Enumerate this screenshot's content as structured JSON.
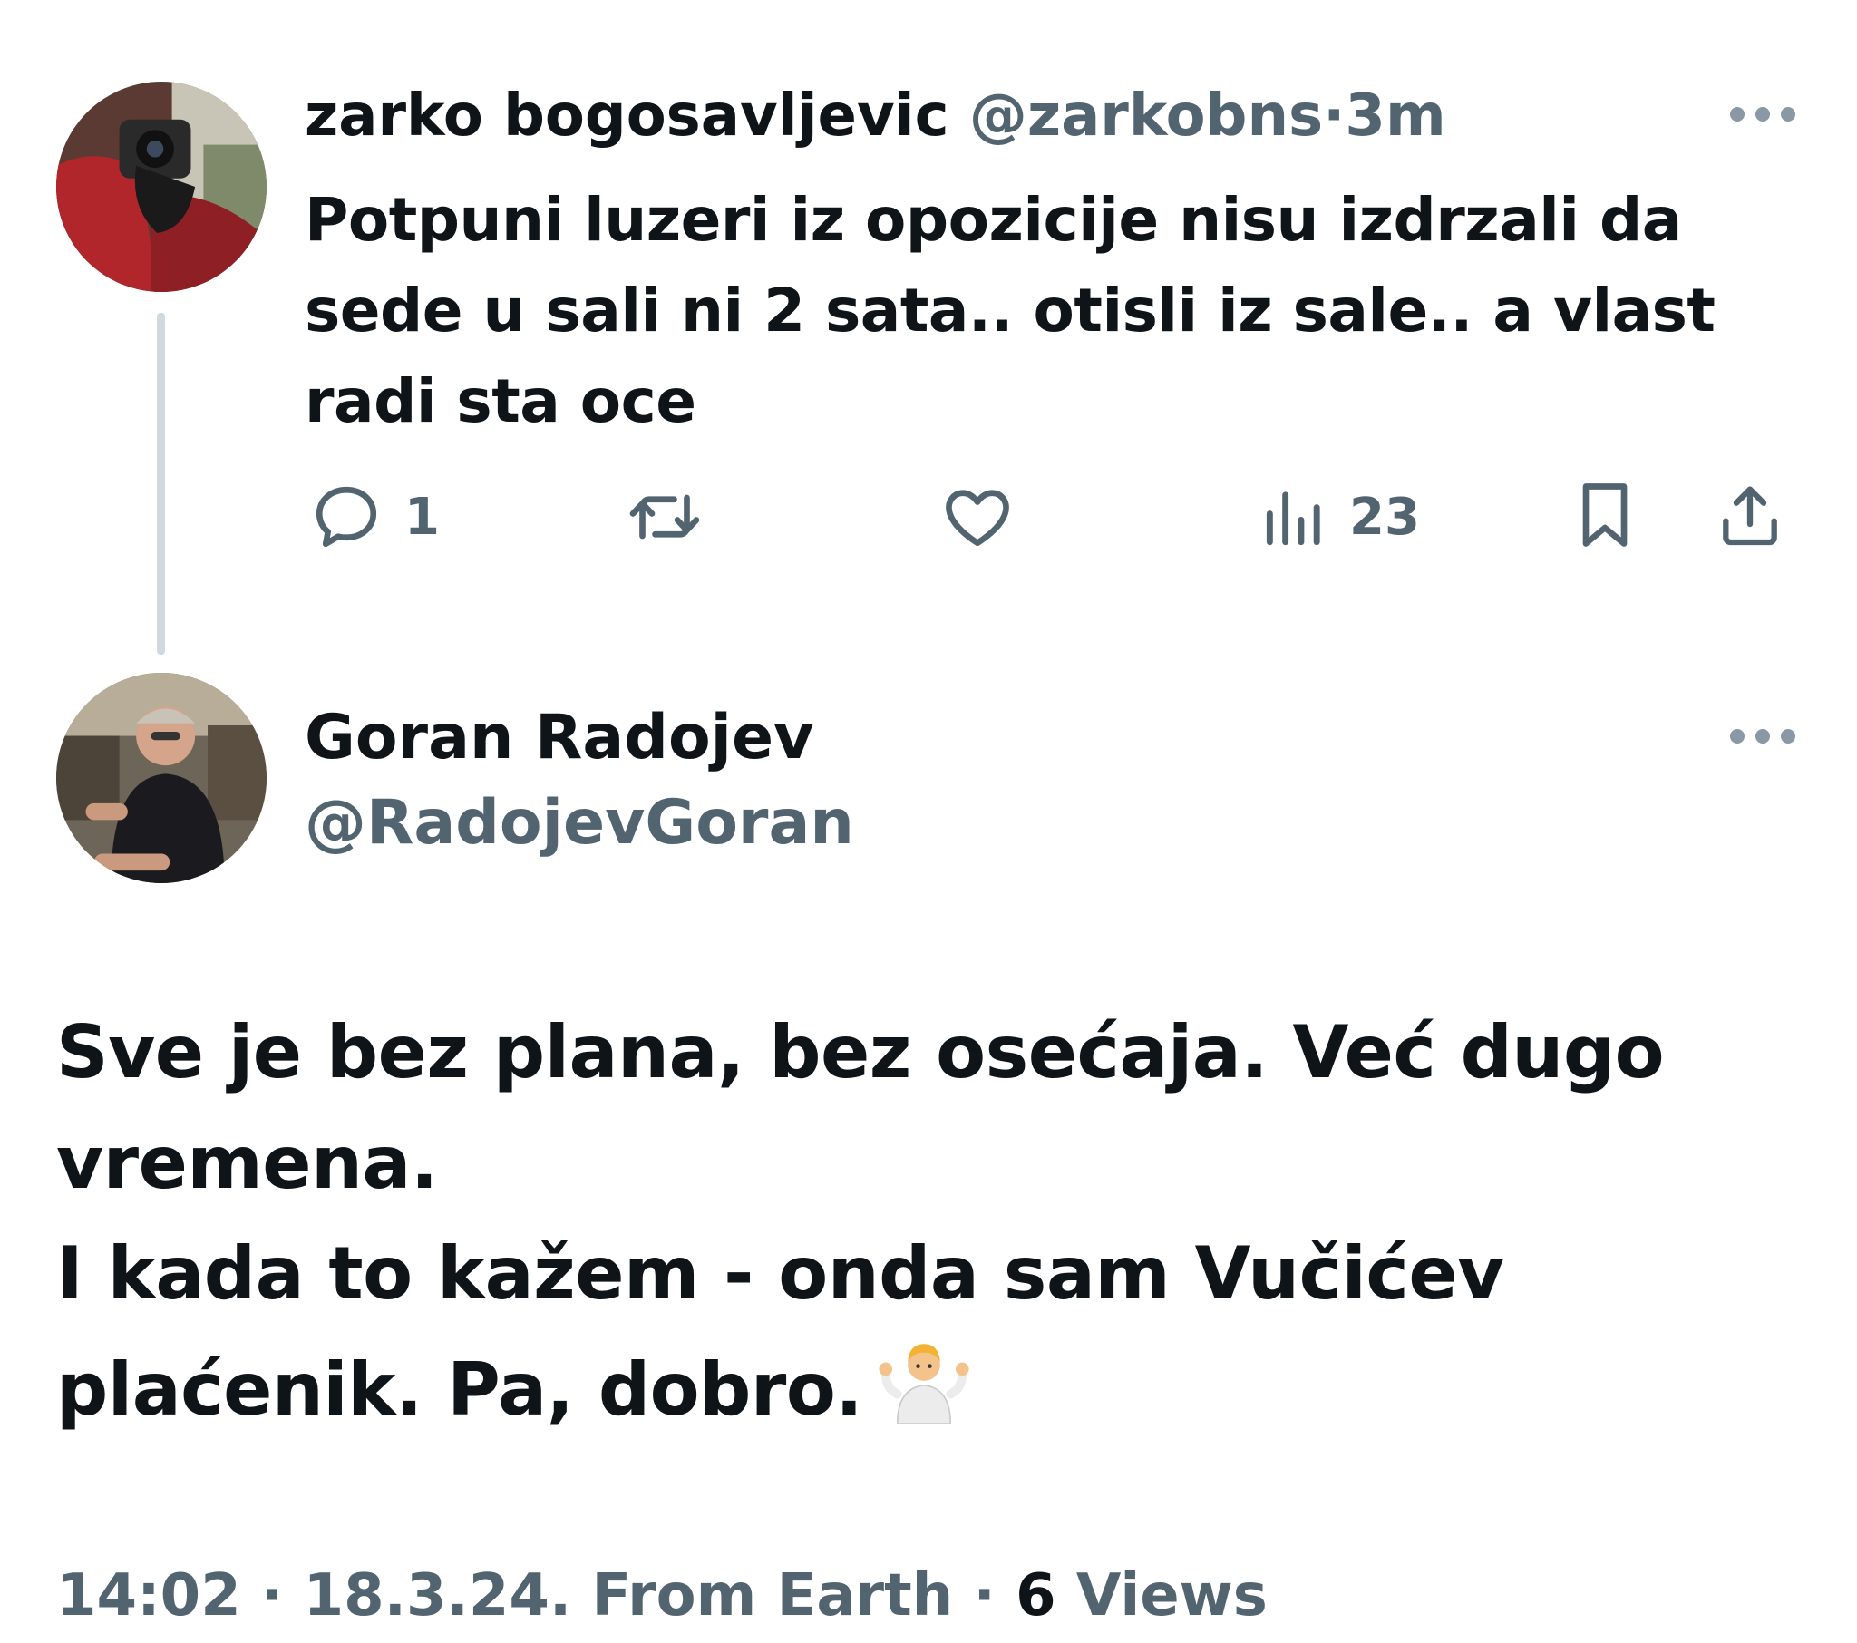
{
  "tweet1": {
    "name": "zarko bogosavljevic",
    "handle": "@zarkobns",
    "separator": "·",
    "time": "3m",
    "text": "Potpuni luzeri iz opozicije nisu izdrzali da sede u sali ni 2 sata.. otisli iz sale.. a vlast radi sta oce",
    "actions": {
      "reply_count": "1",
      "retweet_count": "",
      "like_count": "",
      "views_count": "23"
    }
  },
  "tweet2": {
    "name": "Goran Radojev",
    "handle": "@RadojevGoran",
    "text_line1": "Sve je bez plana, bez osećaja. Već dugo vremena.",
    "text_line2": "I kada to kažem - onda sam Vučićev plaćenik. Pa, dobro.",
    "emoji": "person-shrugging-emoji",
    "meta": {
      "time": "14:02",
      "sep1": " · ",
      "date": "18.3.24.",
      "source": "From Earth",
      "sep2": " · ",
      "views_number": "6",
      "views_label": "Views"
    }
  },
  "colors": {
    "text": "#0f1419",
    "muted": "#536471",
    "thread_line": "#cfd9de"
  }
}
